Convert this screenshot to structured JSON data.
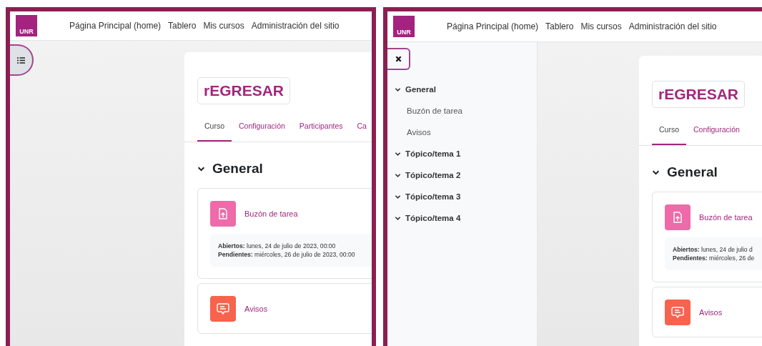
{
  "panels": [
    {
      "logo": "UNR",
      "nav": [
        "Página Principal (home)",
        "Tablero",
        "Mis cursos",
        "Administración del sitio"
      ],
      "drawer": {
        "open": false
      },
      "course": {
        "title": "rEGRESAR",
        "tabs": [
          {
            "label": "Curso",
            "selected": true
          },
          {
            "label": "Configuración",
            "selected": false
          },
          {
            "label": "Participantes",
            "selected": false
          },
          {
            "label": "Ca",
            "selected": false
          }
        ],
        "section": {
          "title": "General",
          "expanded": true,
          "activities": [
            {
              "kind": "assign",
              "name": "Buzón de tarea",
              "dates": [
                {
                  "label": "Abiertos:",
                  "value": "lunes, 24 de julio de 2023, 00:00"
                },
                {
                  "label": "Pendientes:",
                  "value": "miércoles, 26 de julio de 2023, 00:00"
                }
              ]
            },
            {
              "kind": "forum",
              "name": "Avisos"
            }
          ]
        }
      }
    },
    {
      "logo": "UNR",
      "nav": [
        "Página Principal (home)",
        "Tablero",
        "Mis cursos",
        "Administración del sitio"
      ],
      "drawer": {
        "open": true,
        "sections": [
          {
            "title": "General",
            "expanded": true,
            "children": [
              "Buzón de tarea",
              "Avisos"
            ]
          },
          {
            "title": "Tópico/tema 1",
            "expanded": true
          },
          {
            "title": "Tópico/tema 2",
            "expanded": true
          },
          {
            "title": "Tópico/tema 3",
            "expanded": true
          },
          {
            "title": "Tópico/tema 4",
            "expanded": true
          }
        ]
      },
      "course": {
        "title": "rEGRESAR",
        "tabs": [
          {
            "label": "Curso",
            "selected": true
          },
          {
            "label": "Configuración",
            "selected": false
          }
        ],
        "section": {
          "title": "General",
          "expanded": true,
          "activities": [
            {
              "kind": "assign",
              "name": "Buzón de tarea",
              "dates": [
                {
                  "label": "Abiertos:",
                  "value": "lunes, 24 de julio d"
                },
                {
                  "label": "Pendientes:",
                  "value": "miércoles, 26 de"
                }
              ]
            },
            {
              "kind": "forum",
              "name": "Avisos"
            }
          ]
        }
      }
    }
  ]
}
